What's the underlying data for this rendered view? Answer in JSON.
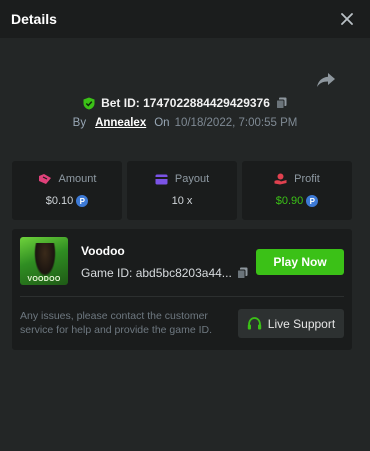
{
  "header": {
    "title": "Details",
    "close_icon": "close-icon"
  },
  "bet": {
    "id_label": "Bet ID:",
    "id_value": "1747022884429429376",
    "by_label": "By",
    "user": "Annealex",
    "on_label": "On",
    "datetime": "10/18/2022, 7:00:55 PM"
  },
  "stats": {
    "amount": {
      "label": "Amount",
      "value": "$0.10",
      "icon": "money-wings-icon"
    },
    "payout": {
      "label": "Payout",
      "value": "10 x",
      "icon": "wallet-icon"
    },
    "profit": {
      "label": "Profit",
      "value": "$0.90",
      "icon": "coins-hand-icon"
    }
  },
  "coin_symbol": "P",
  "game": {
    "name": "Voodoo",
    "thumb_text": "VOODOO",
    "id_label": "Game ID:",
    "id_value": "abd5bc8203a44...",
    "play_label": "Play Now",
    "notice": "Any issues, please contact the customer service for help and provide the game ID.",
    "support_label": "Live Support"
  },
  "colors": {
    "background": "#232626",
    "header": "#1b1d1d",
    "card": "#1a1c1c",
    "green": "#3bc117",
    "coin": "#3d7ad6",
    "amount_icon": "#e0417a",
    "payout_icon": "#7b53e6",
    "profit_icon": "#e0414f"
  }
}
